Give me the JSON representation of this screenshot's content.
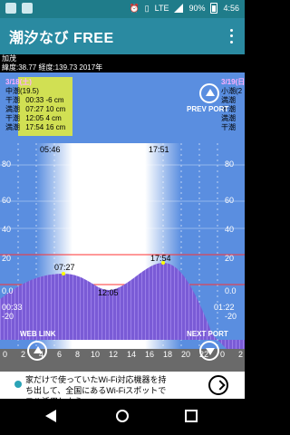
{
  "status": {
    "network": "LTE",
    "battery": "90%",
    "time": "4:56"
  },
  "app": {
    "title": "潮汐なび FREE"
  },
  "location": {
    "name": "加茂",
    "coords": "緯度:38.77 経度:139.73   2017年"
  },
  "panel": {
    "left_date": "3/18(土)",
    "left_tide_type": "中潮",
    "left_moon_age": "(19.5)",
    "left_rows": [
      {
        "type": "干潮",
        "time": "00:33",
        "level": "-6 cm"
      },
      {
        "type": "満潮",
        "time": "07:27",
        "level": "10 cm"
      },
      {
        "type": "干潮",
        "time": "12:05",
        "level": "4 cm"
      },
      {
        "type": "満潮",
        "time": "17:54",
        "level": "16 cm"
      }
    ],
    "right_date": "3/19(日)",
    "right_tide_type": "小潮",
    "right_moon_age": "(2",
    "right_rows": [
      {
        "type": "満潮",
        "time": ""
      },
      {
        "type": "干潮",
        "time": ""
      },
      {
        "type": "満潮",
        "time": ""
      },
      {
        "type": "干潮",
        "time": ""
      }
    ],
    "prev_port": "PREV PORT",
    "next_port": "NEXT PORT",
    "web_link": "WEB LINK",
    "sunrise": "05:46",
    "sunset": "17:51",
    "high1": "07:27",
    "high2": "17:54",
    "low": "12:05",
    "left_edge_time": "00:33",
    "right_edge_time": "01:22",
    "y_ticks": [
      "80",
      "60",
      "40",
      "20",
      "0.0",
      "-20"
    ],
    "x_ticks": [
      "0",
      "2",
      "4",
      "6",
      "8",
      "10",
      "12",
      "14",
      "16",
      "18",
      "20",
      "22",
      "0",
      "2"
    ]
  },
  "ad": {
    "line1": "家だけで使っていたWi-Fi対応機器を持",
    "line2": "ち出して、全国にあるWi-Fiスポットで",
    "line3": "フル活用しよう"
  }
}
